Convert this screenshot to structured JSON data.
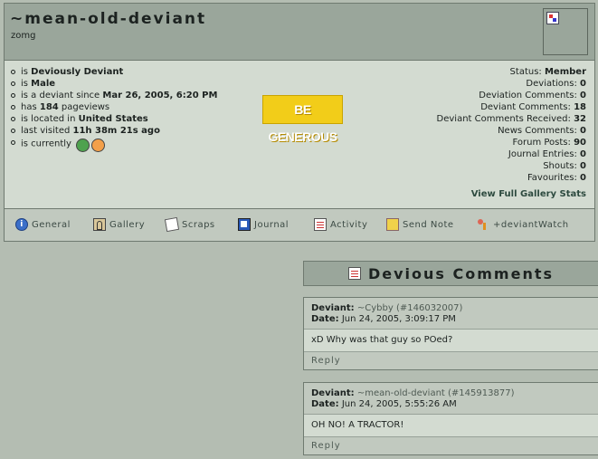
{
  "profile": {
    "username": "~mean-old-deviant",
    "tagline": "zomg",
    "info": [
      {
        "pre": "is ",
        "bold": "Deviously Deviant",
        "post": ""
      },
      {
        "pre": "is ",
        "bold": "Male",
        "post": ""
      },
      {
        "pre": "is a deviant since ",
        "bold": "Mar 26, 2005, 6:20 PM",
        "post": ""
      },
      {
        "pre": "has ",
        "bold": "184",
        "post": " pageviews"
      },
      {
        "pre": "is located in ",
        "bold": "United States",
        "post": ""
      },
      {
        "pre": "last visited ",
        "bold": "11h 38m 21s ago",
        "post": ""
      },
      {
        "pre": "is currently",
        "bold": "",
        "post": ""
      }
    ],
    "generous_label": "BE GENEROUS",
    "stats": [
      {
        "label": "Status:",
        "value": "Member"
      },
      {
        "label": "Deviations:",
        "value": "0"
      },
      {
        "label": "Deviation Comments:",
        "value": "0"
      },
      {
        "label": "Deviant Comments:",
        "value": "18"
      },
      {
        "label": "Deviant Comments Received:",
        "value": "32"
      },
      {
        "label": "News Comments:",
        "value": "0"
      },
      {
        "label": "Forum Posts:",
        "value": "90"
      },
      {
        "label": "Journal Entries:",
        "value": "0"
      },
      {
        "label": "Shouts:",
        "value": "0"
      },
      {
        "label": "Favourites:",
        "value": "0"
      }
    ],
    "stats_link": "View Full Gallery Stats"
  },
  "nav": [
    {
      "label": "General",
      "icon": "info-icon"
    },
    {
      "label": "Gallery",
      "icon": "gallery-icon"
    },
    {
      "label": "Scraps",
      "icon": "scraps-icon"
    },
    {
      "label": "Journal",
      "icon": "journal-icon"
    },
    {
      "label": "Activity",
      "icon": "activity-icon"
    },
    {
      "label": "Send Note",
      "icon": "note-icon"
    },
    {
      "label": "+deviantWatch",
      "icon": "watch-icon"
    }
  ],
  "comments_section": {
    "title": "Devious Comments",
    "comments": [
      {
        "deviant_label": "Deviant:",
        "deviant": "~Cybby",
        "id": "(#146032007)",
        "date_label": "Date:",
        "date": "Jun 24, 2005, 3:09:17 PM",
        "text": "xD Why was that guy so POed?",
        "reply": "Reply"
      },
      {
        "deviant_label": "Deviant:",
        "deviant": "~mean-old-deviant",
        "id": "(#145913877)",
        "date_label": "Date:",
        "date": "Jun 24, 2005, 5:55:26 AM",
        "text": "OH NO! A TRACTOR!",
        "reply": "Reply"
      }
    ]
  }
}
